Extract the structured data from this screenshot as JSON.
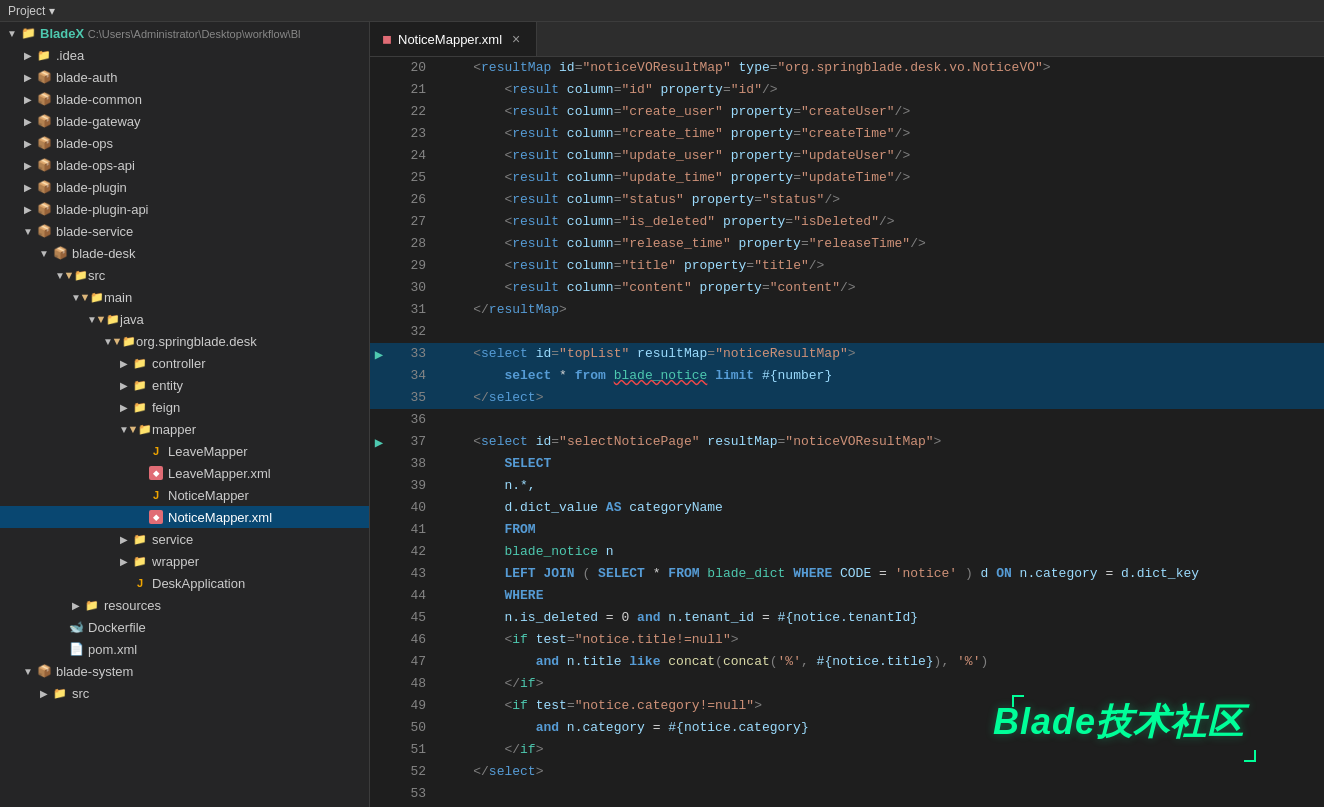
{
  "topbar": {
    "project_label": "Project ▾"
  },
  "sidebar": {
    "title": "Project",
    "root_label": "BladeX",
    "root_path": "C:\\Users\\Administrator\\Desktop\\workflow\\Bl",
    "items": [
      {
        "id": "idea",
        "label": ".idea",
        "type": "folder",
        "indent": 1,
        "open": false,
        "arrow": "▶"
      },
      {
        "id": "blade-auth",
        "label": "blade-auth",
        "type": "module",
        "indent": 1,
        "open": false,
        "arrow": "▶"
      },
      {
        "id": "blade-common",
        "label": "blade-common",
        "type": "module",
        "indent": 1,
        "open": false,
        "arrow": "▶"
      },
      {
        "id": "blade-gateway",
        "label": "blade-gateway",
        "type": "module",
        "indent": 1,
        "open": false,
        "arrow": "▶"
      },
      {
        "id": "blade-ops",
        "label": "blade-ops",
        "type": "module",
        "indent": 1,
        "open": false,
        "arrow": "▶"
      },
      {
        "id": "blade-ops-api",
        "label": "blade-ops-api",
        "type": "module",
        "indent": 1,
        "open": false,
        "arrow": "▶"
      },
      {
        "id": "blade-plugin",
        "label": "blade-plugin",
        "type": "module",
        "indent": 1,
        "open": false,
        "arrow": "▶"
      },
      {
        "id": "blade-plugin-api",
        "label": "blade-plugin-api",
        "type": "module",
        "indent": 1,
        "open": false,
        "arrow": "▶"
      },
      {
        "id": "blade-service",
        "label": "blade-service",
        "type": "module",
        "indent": 1,
        "open": true,
        "arrow": "▼"
      },
      {
        "id": "blade-desk",
        "label": "blade-desk",
        "type": "module",
        "indent": 2,
        "open": true,
        "arrow": "▼"
      },
      {
        "id": "src",
        "label": "src",
        "type": "folder",
        "indent": 3,
        "open": true,
        "arrow": "▼"
      },
      {
        "id": "main",
        "label": "main",
        "type": "folder",
        "indent": 4,
        "open": true,
        "arrow": "▼"
      },
      {
        "id": "java",
        "label": "java",
        "type": "folder",
        "indent": 5,
        "open": true,
        "arrow": "▼"
      },
      {
        "id": "org-springblade-desk",
        "label": "org.springblade.desk",
        "type": "package",
        "indent": 6,
        "open": true,
        "arrow": "▼"
      },
      {
        "id": "controller",
        "label": "controller",
        "type": "package",
        "indent": 7,
        "open": false,
        "arrow": "▶"
      },
      {
        "id": "entity",
        "label": "entity",
        "type": "package",
        "indent": 7,
        "open": false,
        "arrow": "▶"
      },
      {
        "id": "feign",
        "label": "feign",
        "type": "package",
        "indent": 7,
        "open": false,
        "arrow": "▶"
      },
      {
        "id": "mapper",
        "label": "mapper",
        "type": "package",
        "indent": 7,
        "open": true,
        "arrow": "▼"
      },
      {
        "id": "LeaveMapper",
        "label": "LeaveMapper",
        "type": "java",
        "indent": 8,
        "open": false,
        "arrow": ""
      },
      {
        "id": "LeaveMapper-xml",
        "label": "LeaveMapper.xml",
        "type": "xml",
        "indent": 8,
        "open": false,
        "arrow": ""
      },
      {
        "id": "NoticeMapper",
        "label": "NoticeMapper",
        "type": "java",
        "indent": 8,
        "open": false,
        "arrow": ""
      },
      {
        "id": "NoticeMapper-xml",
        "label": "NoticeMapper.xml",
        "type": "xml",
        "indent": 8,
        "open": false,
        "arrow": "",
        "selected": true
      },
      {
        "id": "service",
        "label": "service",
        "type": "package",
        "indent": 7,
        "open": false,
        "arrow": "▶"
      },
      {
        "id": "wrapper",
        "label": "wrapper",
        "type": "package",
        "indent": 7,
        "open": false,
        "arrow": "▶"
      },
      {
        "id": "DeskApplication",
        "label": "DeskApplication",
        "type": "java",
        "indent": 7,
        "open": false,
        "arrow": ""
      },
      {
        "id": "resources",
        "label": "resources",
        "type": "folder",
        "indent": 4,
        "open": false,
        "arrow": "▶"
      },
      {
        "id": "Dockerfile",
        "label": "Dockerfile",
        "type": "docker",
        "indent": 3,
        "open": false,
        "arrow": ""
      },
      {
        "id": "pom-xml",
        "label": "pom.xml",
        "type": "pom",
        "indent": 3,
        "open": false,
        "arrow": ""
      },
      {
        "id": "blade-system",
        "label": "blade-system",
        "type": "module",
        "indent": 1,
        "open": true,
        "arrow": "▼"
      },
      {
        "id": "src-system",
        "label": "src",
        "type": "folder",
        "indent": 2,
        "open": false,
        "arrow": "▶"
      }
    ]
  },
  "tab": {
    "filename": "NoticeMapper.xml",
    "close_label": "×"
  },
  "editor": {
    "lines": [
      {
        "num": 20,
        "marker": "",
        "content_html": "    <span class='xml-punct'>&lt;</span><span class='xml-tag'>resultMap</span> <span class='xml-attr'>id</span><span class='xml-punct'>=</span><span class='xml-val'>\"noticeVOResultMap\"</span> <span class='xml-attr'>type</span><span class='xml-punct'>=</span><span class='xml-val'>\"org.springblade.desk.vo.NoticeVO\"</span><span class='xml-punct'>&gt;</span>"
      },
      {
        "num": 21,
        "marker": "",
        "content_html": "        <span class='xml-punct'>&lt;</span><span class='xml-tag'>result</span> <span class='xml-attr'>column</span><span class='xml-punct'>=</span><span class='xml-val'>\"id\"</span> <span class='xml-attr'>property</span><span class='xml-punct'>=</span><span class='xml-val'>\"id\"</span><span class='xml-punct'>/&gt;</span>"
      },
      {
        "num": 22,
        "marker": "",
        "content_html": "        <span class='xml-punct'>&lt;</span><span class='xml-tag'>result</span> <span class='xml-attr'>column</span><span class='xml-punct'>=</span><span class='xml-val'>\"create_user\"</span> <span class='xml-attr'>property</span><span class='xml-punct'>=</span><span class='xml-val'>\"createUser\"</span><span class='xml-punct'>/&gt;</span>"
      },
      {
        "num": 23,
        "marker": "",
        "content_html": "        <span class='xml-punct'>&lt;</span><span class='xml-tag'>result</span> <span class='xml-attr'>column</span><span class='xml-punct'>=</span><span class='xml-val'>\"create_time\"</span> <span class='xml-attr'>property</span><span class='xml-punct'>=</span><span class='xml-val'>\"createTime\"</span><span class='xml-punct'>/&gt;</span>"
      },
      {
        "num": 24,
        "marker": "",
        "content_html": "        <span class='xml-punct'>&lt;</span><span class='xml-tag'>result</span> <span class='xml-attr'>column</span><span class='xml-punct'>=</span><span class='xml-val'>\"update_user\"</span> <span class='xml-attr'>property</span><span class='xml-punct'>=</span><span class='xml-val'>\"updateUser\"</span><span class='xml-punct'>/&gt;</span>"
      },
      {
        "num": 25,
        "marker": "",
        "content_html": "        <span class='xml-punct'>&lt;</span><span class='xml-tag'>result</span> <span class='xml-attr'>column</span><span class='xml-punct'>=</span><span class='xml-val'>\"update_time\"</span> <span class='xml-attr'>property</span><span class='xml-punct'>=</span><span class='xml-val'>\"updateTime\"</span><span class='xml-punct'>/&gt;</span>"
      },
      {
        "num": 26,
        "marker": "",
        "content_html": "        <span class='xml-punct'>&lt;</span><span class='xml-tag'>result</span> <span class='xml-attr'>column</span><span class='xml-punct'>=</span><span class='xml-val'>\"status\"</span> <span class='xml-attr'>property</span><span class='xml-punct'>=</span><span class='xml-val'>\"status\"</span><span class='xml-punct'>/&gt;</span>"
      },
      {
        "num": 27,
        "marker": "",
        "content_html": "        <span class='xml-punct'>&lt;</span><span class='xml-tag'>result</span> <span class='xml-attr'>column</span><span class='xml-punct'>=</span><span class='xml-val'>\"is_deleted\"</span> <span class='xml-attr'>property</span><span class='xml-punct'>=</span><span class='xml-val'>\"isDeleted\"</span><span class='xml-punct'>/&gt;</span>"
      },
      {
        "num": 28,
        "marker": "",
        "content_html": "        <span class='xml-punct'>&lt;</span><span class='xml-tag'>result</span> <span class='xml-attr'>column</span><span class='xml-punct'>=</span><span class='xml-val'>\"release_time\"</span> <span class='xml-attr'>property</span><span class='xml-punct'>=</span><span class='xml-val'>\"releaseTime\"</span><span class='xml-punct'>/&gt;</span>"
      },
      {
        "num": 29,
        "marker": "",
        "content_html": "        <span class='xml-punct'>&lt;</span><span class='xml-tag'>result</span> <span class='xml-attr'>column</span><span class='xml-punct'>=</span><span class='xml-val'>\"title\"</span> <span class='xml-attr'>property</span><span class='xml-punct'>=</span><span class='xml-val'>\"title\"</span><span class='xml-punct'>/&gt;</span>"
      },
      {
        "num": 30,
        "marker": "",
        "content_html": "        <span class='xml-punct'>&lt;</span><span class='xml-tag'>result</span> <span class='xml-attr'>column</span><span class='xml-punct'>=</span><span class='xml-val'>\"content\"</span> <span class='xml-attr'>property</span><span class='xml-punct'>=</span><span class='xml-val'>\"content\"</span><span class='xml-punct'>/&gt;</span>"
      },
      {
        "num": 31,
        "marker": "",
        "content_html": "    <span class='xml-punct'>&lt;/</span><span class='xml-tag'>resultMap</span><span class='xml-punct'>&gt;</span>"
      },
      {
        "num": 32,
        "marker": "",
        "content_html": ""
      },
      {
        "num": 33,
        "marker": "🔵",
        "content_html": "    <span class='xml-punct'>&lt;</span><span class='xml-tag'>select</span> <span class='xml-attr'>id</span><span class='xml-punct'>=</span><span class='xml-val'>\"topList\"</span> <span class='xml-attr'>resultMap</span><span class='xml-punct'>=</span><span class='xml-val'>\"noticeResultMap\"</span><span class='xml-punct'>&gt;</span>",
        "highlight": true
      },
      {
        "num": 34,
        "marker": "",
        "content_html": "        <span class='sql-keyword'>select</span> <span class='xml-text'>*</span> <span class='sql-keyword'>from</span> <span class='sql-tbl squiggle'>blade_notice</span> <span class='sql-keyword'>limit</span> <span class='sql-param'>#{number}</span>",
        "highlight": true
      },
      {
        "num": 35,
        "marker": "",
        "content_html": "    <span class='xml-punct'>&lt;/</span><span class='xml-tag'>select</span><span class='xml-punct'>&gt;</span>",
        "highlight": true
      },
      {
        "num": 36,
        "marker": "",
        "content_html": ""
      },
      {
        "num": 37,
        "marker": "🔵",
        "content_html": "    <span class='xml-punct'>&lt;</span><span class='xml-tag'>select</span> <span class='xml-attr'>id</span><span class='xml-punct'>=</span><span class='xml-val'>\"selectNoticePage\"</span> <span class='xml-attr'>resultMap</span><span class='xml-punct'>=</span><span class='xml-val'>\"noticeVOResultMap\"</span><span class='xml-punct'>&gt;</span>"
      },
      {
        "num": 38,
        "marker": "",
        "content_html": "        <span class='sql-keyword'>SELECT</span>"
      },
      {
        "num": 39,
        "marker": "",
        "content_html": "        <span class='sql-col'>n.*,</span>"
      },
      {
        "num": 40,
        "marker": "",
        "content_html": "        <span class='sql-col'>d.dict_value</span> <span class='sql-keyword'>AS</span> <span class='sql-col'>categoryName</span>"
      },
      {
        "num": 41,
        "marker": "",
        "content_html": "        <span class='sql-keyword'>FROM</span>"
      },
      {
        "num": 42,
        "marker": "",
        "content_html": "        <span class='sql-tbl'>blade_notice</span> <span class='sql-col'>n</span>"
      },
      {
        "num": 43,
        "marker": "",
        "content_html": "        <span class='sql-keyword'>LEFT JOIN</span> <span class='xml-punct'>(</span> <span class='sql-keyword'>SELECT</span> <span class='xml-text'>*</span> <span class='sql-keyword'>FROM</span> <span class='sql-tbl'>blade_dict</span> <span class='sql-keyword'>WHERE</span> <span class='sql-col'>CODE</span> <span class='xml-text'>=</span> <span class='sql-str'>'notice'</span> <span class='xml-punct'>)</span> <span class='sql-col'>d</span> <span class='sql-keyword'>ON</span> <span class='sql-col'>n.category</span> <span class='xml-text'>=</span> <span class='sql-col'>d.dict_key</span>"
      },
      {
        "num": 44,
        "marker": "",
        "content_html": "        <span class='sql-keyword'>WHERE</span>"
      },
      {
        "num": 45,
        "marker": "",
        "content_html": "        <span class='sql-col'>n.is_deleted</span> <span class='xml-text'>=</span> <span class='xml-text'>0</span> <span class='sql-keyword'>and</span> <span class='sql-col'>n.tenant_id</span> <span class='xml-text'>=</span> <span class='sql-param'>#{notice.tenantId}</span>"
      },
      {
        "num": 46,
        "marker": "",
        "content_html": "        <span class='xml-punct'>&lt;</span><span class='mybatis-tag'>if</span> <span class='mybatis-attr'>test</span><span class='xml-punct'>=</span><span class='mybatis-val'>\"notice.title!=null\"</span><span class='xml-punct'>&gt;</span>"
      },
      {
        "num": 47,
        "marker": "",
        "content_html": "            <span class='sql-keyword'>and</span> <span class='sql-col'>n.title</span> <span class='sql-keyword'>like</span> <span class='sql-func'>concat</span><span class='xml-punct'>(</span><span class='sql-func'>concat</span><span class='xml-punct'>(</span><span class='sql-str'>'%'</span><span class='xml-punct'>,</span> <span class='sql-param'>#{notice.title}</span><span class='xml-punct'>)</span><span class='xml-punct'>,</span> <span class='sql-str'>'%'</span><span class='xml-punct'>)</span>"
      },
      {
        "num": 48,
        "marker": "",
        "content_html": "        <span class='xml-punct'>&lt;/</span><span class='mybatis-tag'>if</span><span class='xml-punct'>&gt;</span>"
      },
      {
        "num": 49,
        "marker": "",
        "content_html": "        <span class='xml-punct'>&lt;</span><span class='mybatis-tag'>if</span> <span class='mybatis-attr'>test</span><span class='xml-punct'>=</span><span class='mybatis-val'>\"notice.category!=null\"</span><span class='xml-punct'>&gt;</span>"
      },
      {
        "num": 50,
        "marker": "",
        "content_html": "            <span class='sql-keyword'>and</span> <span class='sql-col'>n.category</span> <span class='xml-text'>=</span> <span class='sql-param'>#{notice.category}</span>"
      },
      {
        "num": 51,
        "marker": "",
        "content_html": "        <span class='xml-punct'>&lt;/</span><span class='mybatis-tag'>if</span><span class='xml-punct'>&gt;</span>"
      },
      {
        "num": 52,
        "marker": "",
        "content_html": "    <span class='xml-punct'>&lt;/</span><span class='xml-tag'>select</span><span class='xml-punct'>&gt;</span>"
      },
      {
        "num": 53,
        "marker": "",
        "content_html": ""
      }
    ]
  },
  "watermark": {
    "text": "Blade技术社区"
  }
}
